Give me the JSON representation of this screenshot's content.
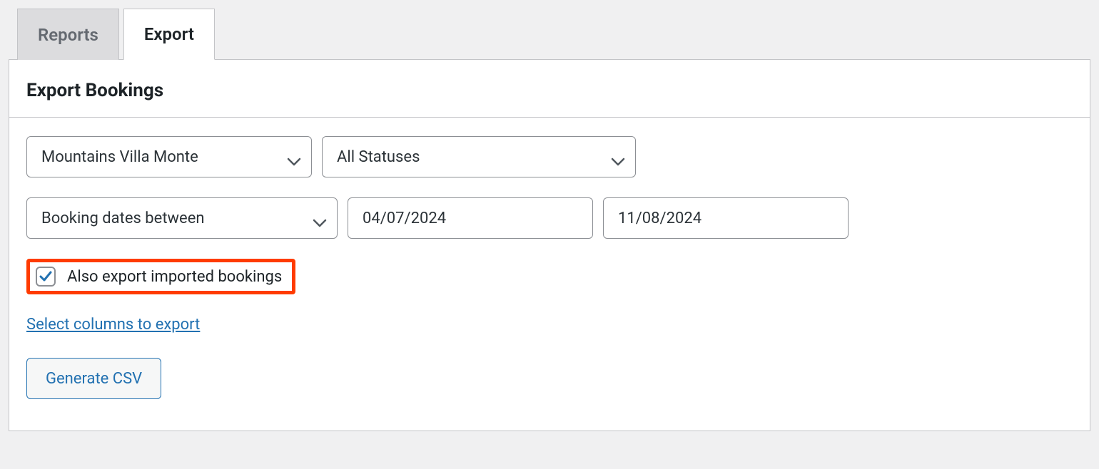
{
  "tabs": {
    "reports": "Reports",
    "export": "Export",
    "active": "export"
  },
  "panel": {
    "heading": "Export Bookings"
  },
  "filters": {
    "accommodation": "Mountains Villa Monte",
    "status": "All Statuses",
    "date_mode": "Booking dates between",
    "date_from": "04/07/2024",
    "date_to": "11/08/2024"
  },
  "checkbox": {
    "label": "Also export imported bookings",
    "checked": true
  },
  "columns_link": "Select columns to export",
  "generate_button": "Generate CSV"
}
